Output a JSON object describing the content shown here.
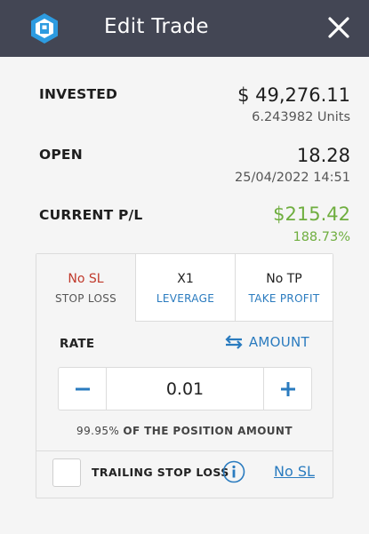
{
  "header": {
    "title": "Edit Trade",
    "logo_icon": "platform-logo-icon",
    "close_icon": "close-icon",
    "bg_color": "#434654"
  },
  "summary": {
    "invested": {
      "label": "INVESTED",
      "value": "$ 49,276.11",
      "sub": "6.243982 Units"
    },
    "open": {
      "label": "OPEN",
      "value": "18.28",
      "sub": "25/04/2022 14:51"
    },
    "current_pl": {
      "label": "CURRENT P/L",
      "value": "$215.42",
      "sub": "188.73%",
      "color": "#6fae3f"
    }
  },
  "tabs": [
    {
      "value": "No SL",
      "label": "STOP LOSS",
      "active": true
    },
    {
      "value": "X1",
      "label": "LEVERAGE",
      "active": false
    },
    {
      "value": "No TP",
      "label": "TAKE PROFIT",
      "active": false
    }
  ],
  "rate": {
    "label": "RATE",
    "toggle_label": "AMOUNT",
    "toggle_icon": "swap-arrows-icon",
    "value": "0.01",
    "minus_icon": "minus-icon",
    "plus_icon": "plus-icon",
    "hint_pct": "99.95%",
    "hint_text": "OF THE POSITION AMOUNT"
  },
  "trailing": {
    "label": "TRAILING STOP LOSS",
    "checked": false,
    "info_icon": "info-icon",
    "link": "No SL"
  },
  "colors": {
    "accent": "#2a7bbf",
    "danger": "#c0392b",
    "profit": "#6fae3f"
  }
}
